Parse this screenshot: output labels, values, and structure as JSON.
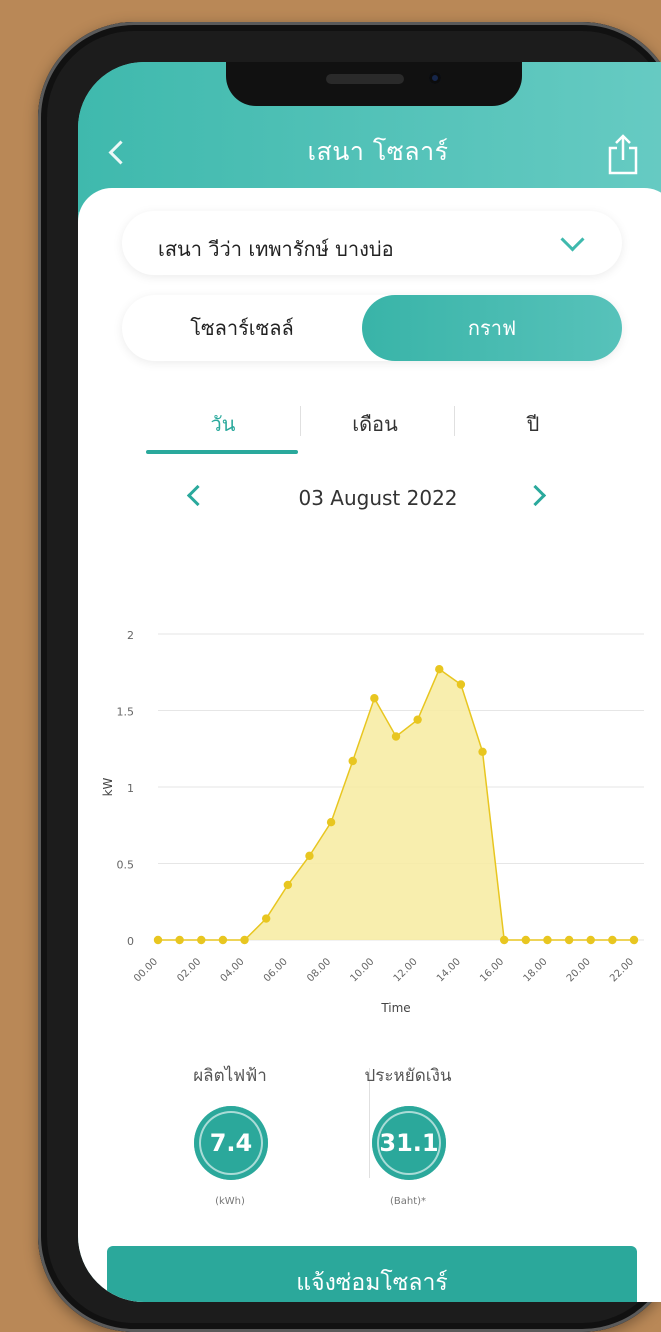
{
  "app": {
    "title": "เสนา โซลาร์",
    "back_icon": "chevron-left-icon",
    "share_icon": "share-icon"
  },
  "project_selector": {
    "value": "เสนา วีว่า เทพารักษ์ บางบ่อ",
    "icon": "chevron-down-icon"
  },
  "view_toggle": {
    "options": [
      "โซลาร์เซลล์",
      "กราฟ"
    ],
    "selected": "กราฟ"
  },
  "period_tabs": {
    "items": [
      "วัน",
      "เดือน",
      "ปี"
    ],
    "active": "วัน"
  },
  "date_nav": {
    "date": "03 August 2022",
    "prev_icon": "chevron-left-icon",
    "next_icon": "chevron-right-icon"
  },
  "colors": {
    "accent": "#2ba89b",
    "series_line": "#e8c620",
    "series_fill": "#f7eba0"
  },
  "chart_data": {
    "type": "area",
    "xlabel": "Time",
    "ylabel": "kW",
    "ylim": [
      0,
      2
    ],
    "yticks": [
      "0",
      "0.5",
      "1",
      "1.5",
      "2"
    ],
    "xticks": [
      "00.00",
      "02.00",
      "04.00",
      "06.00",
      "08.00",
      "10.00",
      "12.00",
      "14.00",
      "16.00",
      "18.00",
      "20.00",
      "22.00"
    ],
    "grid": true,
    "x": [
      0,
      1,
      2,
      3,
      4,
      5,
      6,
      7,
      8,
      9,
      10,
      11,
      12,
      13,
      14,
      15,
      16,
      17,
      18,
      19,
      20,
      21,
      22
    ],
    "values": [
      0,
      0,
      0,
      0,
      0,
      0.14,
      0.36,
      0.55,
      0.77,
      1.17,
      1.58,
      1.33,
      1.44,
      1.77,
      1.67,
      1.23,
      0,
      0,
      0,
      0,
      0,
      0,
      0
    ]
  },
  "stats": [
    {
      "label": "ผลิตไฟฟ้า",
      "value": "7.4",
      "unit": "(kWh)"
    },
    {
      "label": "ประหยัดเงิน",
      "value": "31.1",
      "unit": "(Baht)*"
    }
  ],
  "repair_button": {
    "label": "แจ้งซ่อมโซลาร์"
  }
}
